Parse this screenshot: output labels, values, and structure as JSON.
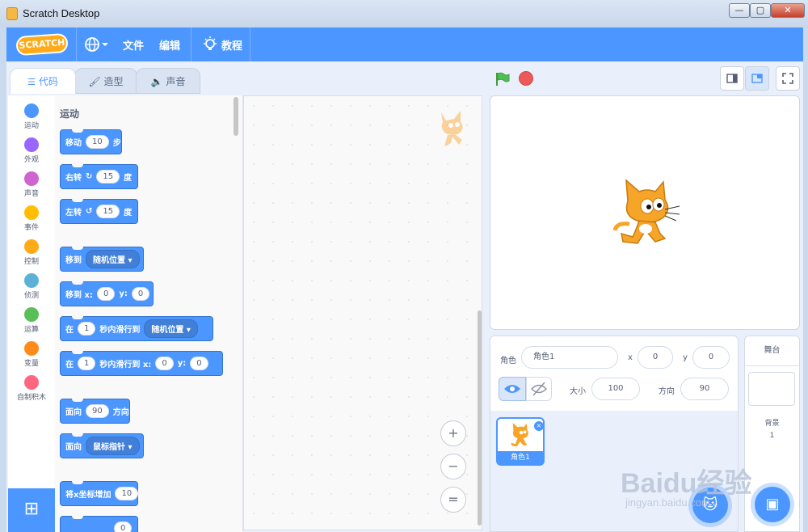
{
  "window": {
    "title": "Scratch Desktop",
    "minimize": "—",
    "maximize": "▢",
    "close": "✕"
  },
  "menubar": {
    "logo": "SCRATCH",
    "file": "文件",
    "edit": "编辑",
    "tutorials": "教程"
  },
  "tabs": {
    "code": "代码",
    "costumes": "造型",
    "sounds": "声音"
  },
  "categories": [
    {
      "label": "运动",
      "color": "#4c97ff"
    },
    {
      "label": "外观",
      "color": "#9966ff"
    },
    {
      "label": "声音",
      "color": "#cf63cf"
    },
    {
      "label": "事件",
      "color": "#ffbf00"
    },
    {
      "label": "控制",
      "color": "#ffab19"
    },
    {
      "label": "侦测",
      "color": "#5cb1d6"
    },
    {
      "label": "运算",
      "color": "#59c059"
    },
    {
      "label": "变量",
      "color": "#ff8c1a"
    },
    {
      "label": "自制积木",
      "color": "#ff6680"
    }
  ],
  "palette": {
    "section_title": "运动",
    "move": {
      "prefix": "移动",
      "steps": "10",
      "suffix": "步"
    },
    "turn_right": {
      "prefix": "右转",
      "icon": "↻",
      "degrees": "15",
      "suffix": "度"
    },
    "turn_left": {
      "prefix": "左转",
      "icon": "↺",
      "degrees": "15",
      "suffix": "度"
    },
    "goto": {
      "prefix": "移到",
      "target": "随机位置"
    },
    "goto_xy": {
      "prefix": "移到 x:",
      "x": "0",
      "ylabel": "y:",
      "y": "0"
    },
    "glide": {
      "prefix": "在",
      "secs": "1",
      "mid": "秒内滑行到",
      "target": "随机位置"
    },
    "glide_xy": {
      "prefix": "在",
      "secs": "1",
      "mid": "秒内滑行到 x:",
      "x": "0",
      "ylabel": "y:",
      "y": "0"
    },
    "point_dir": {
      "prefix": "面向",
      "dir": "90",
      "suffix": "方向"
    },
    "point_towards": {
      "prefix": "面向",
      "target": "鼠标指针"
    },
    "change_x": {
      "prefix": "将x坐标增加",
      "value": "10"
    },
    "set_x": {
      "value": "0"
    }
  },
  "zoom": {
    "in": "+",
    "out": "−",
    "reset": "="
  },
  "sprite_info": {
    "sprite_label": "角色",
    "sprite_name": "角色1",
    "x_label": "x",
    "x_value": "0",
    "y_label": "y",
    "y_value": "0",
    "size_label": "大小",
    "size_value": "100",
    "direction_label": "方向",
    "direction_value": "90"
  },
  "sprite_list": {
    "thumb_label": "角色1",
    "delete": "×"
  },
  "stage_panel": {
    "title": "舞台",
    "backdrops_label": "背景",
    "backdrops_count": "1"
  },
  "watermark": {
    "logo": "Baidu经验",
    "url": "jingyan.baidu.com"
  },
  "colors": {
    "accent": "#4c97ff",
    "menubar": "#4c97ff",
    "stop": "#ec5959",
    "flag": "#4cbf56"
  }
}
